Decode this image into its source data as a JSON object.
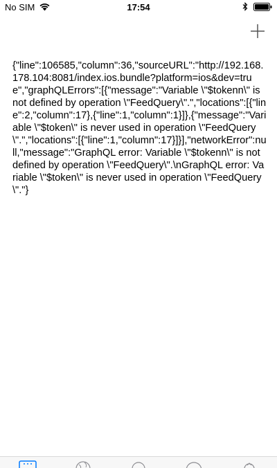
{
  "status_bar": {
    "carrier": "No SIM",
    "time": "17:54",
    "wifi_icon": "wifi-icon",
    "bluetooth_icon": "bluetooth-icon",
    "battery_icon": "battery-icon"
  },
  "header": {
    "add_icon": "plus-icon"
  },
  "error": {
    "message": "{\"line\":106585,\"column\":36,\"sourceURL\":\"http://192.168.178.104:8081/index.ios.bundle?platform=ios&dev=true\",\"graphQLErrors\":[{\"message\":\"Variable \\\"$tokenn\\\" is not defined by operation \\\"FeedQuery\\\".\",\"locations\":[{\"line\":2,\"column\":17},{\"line\":1,\"column\":1}]},{\"message\":\"Variable \\\"$token\\\" is never used in operation \\\"FeedQuery\\\".\",\"locations\":[{\"line\":1,\"column\":17}]}],\"networkError\":null,\"message\":\"GraphQL error: Variable \\\"$tokenn\\\" is not defined by operation \\\"FeedQuery\\\".\\nGraphQL error: Variable \\\"$token\\\" is never used in operation \\\"FeedQuery\\\".\"}"
  },
  "tab_bar": {
    "tabs": [
      {
        "icon": "feed-icon",
        "active": true
      },
      {
        "icon": "globe-icon",
        "active": false
      },
      {
        "icon": "circle-icon",
        "active": false
      },
      {
        "icon": "arc-icon",
        "active": false
      },
      {
        "icon": "profile-icon",
        "active": false
      }
    ]
  },
  "colors": {
    "accent": "#007aff",
    "tab_inactive": "#8e8e93",
    "separator": "#d9d9d9"
  }
}
